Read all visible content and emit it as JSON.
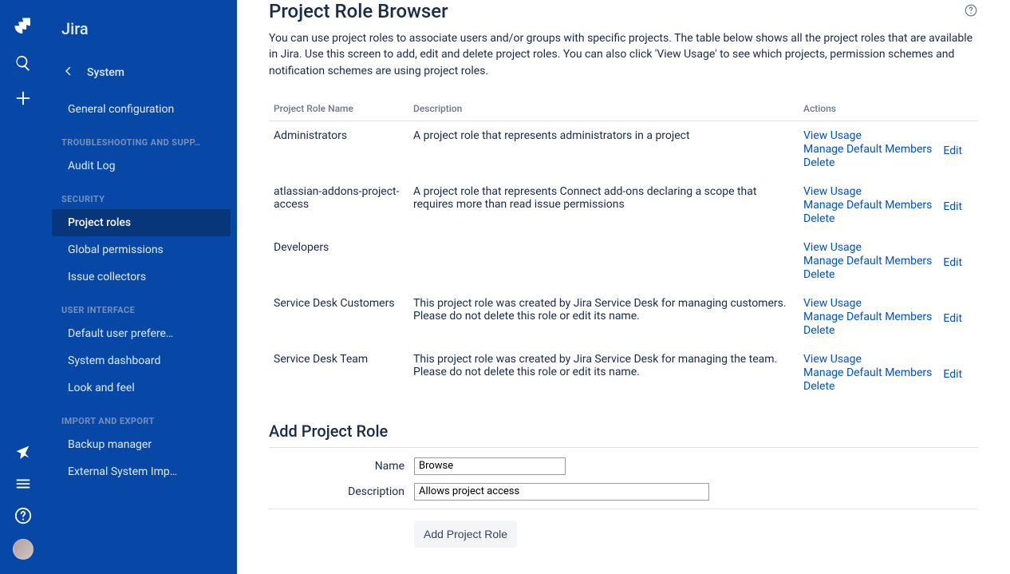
{
  "app": {
    "name": "Jira"
  },
  "sidebar": {
    "sub_header": "System",
    "groups": [
      {
        "type": "item",
        "label": "General configuration"
      },
      {
        "type": "header",
        "label": "TROUBLESHOOTING AND SUPP…"
      },
      {
        "type": "item",
        "label": "Audit Log"
      },
      {
        "type": "header",
        "label": "SECURITY"
      },
      {
        "type": "item",
        "label": "Project roles",
        "active": true
      },
      {
        "type": "item",
        "label": "Global permissions"
      },
      {
        "type": "item",
        "label": "Issue collectors"
      },
      {
        "type": "header",
        "label": "USER INTERFACE"
      },
      {
        "type": "item",
        "label": "Default user prefere…"
      },
      {
        "type": "item",
        "label": "System dashboard"
      },
      {
        "type": "item",
        "label": "Look and feel"
      },
      {
        "type": "header",
        "label": "IMPORT AND EXPORT"
      },
      {
        "type": "item",
        "label": "Backup manager"
      },
      {
        "type": "item",
        "label": "External System Imp…"
      }
    ]
  },
  "page": {
    "title": "Project Role Browser",
    "intro": "You can use project roles to associate users and/or groups with specific projects. The table below shows all the project roles that are available in Jira. Use this screen to add, edit and delete project roles. You can also click 'View Usage' to see which projects, permission schemes and notification schemes are using project roles."
  },
  "table": {
    "columns": {
      "name": "Project Role Name",
      "description": "Description",
      "actions": "Actions"
    },
    "action_labels": {
      "view": "View Usage",
      "manage": "Manage Default Members",
      "delete": "Delete",
      "edit": "Edit"
    },
    "rows": [
      {
        "name": "Administrators",
        "description": "A project role that represents administrators in a project"
      },
      {
        "name": "atlassian-addons-project-access",
        "description": "A project role that represents Connect add-ons declaring a scope that requires more than read issue permissions"
      },
      {
        "name": "Developers",
        "description": ""
      },
      {
        "name": "Service Desk Customers",
        "description": "This project role was created by Jira Service Desk for managing customers. Please do not delete this role or edit its name."
      },
      {
        "name": "Service Desk Team",
        "description": "This project role was created by Jira Service Desk for managing the team. Please do not delete this role or edit its name."
      }
    ]
  },
  "form": {
    "title": "Add Project Role",
    "name_label": "Name",
    "name_value": "Browse",
    "description_label": "Description",
    "description_value": "Allows project access",
    "submit_label": "Add Project Role"
  }
}
